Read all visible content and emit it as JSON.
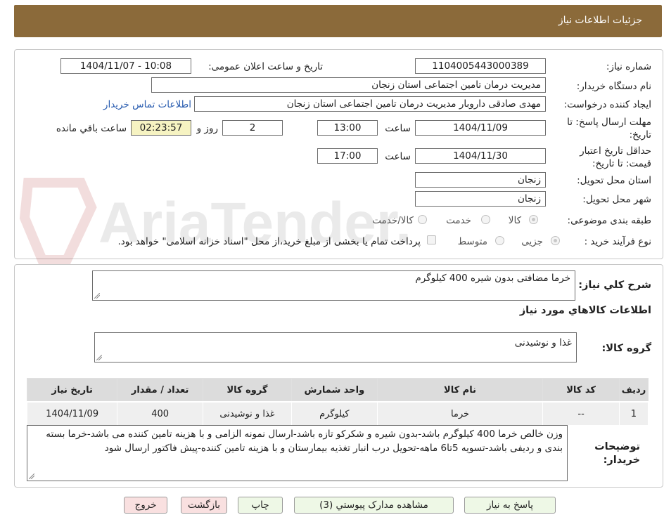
{
  "header": {
    "title": "جزئیات اطلاعات نیاز"
  },
  "form": {
    "need_number_label": "شماره نیاز:",
    "need_number": "1104005443000389",
    "announce_label": "تاریخ و ساعت اعلان عمومی:",
    "announce_value": "1404/11/07 - 10:08",
    "buyer_org_label": "نام دستگاه خریدار:",
    "buyer_org": "مدیریت درمان تامین اجتماعی استان زنجان",
    "requester_label": "ایجاد کننده درخواست:",
    "requester": "مهدی صادقی داروبار مدیریت درمان تامین اجتماعی استان زنجان",
    "buyer_contact_link": "اطلاعات تماس خریدار",
    "reply_deadline_label_1": "مهلت ارسال پاسخ: تا",
    "reply_deadline_label_2": "تاریخ:",
    "reply_date": "1404/11/09",
    "time_label": "ساعت",
    "reply_time": "13:00",
    "days_value": "2",
    "days_label": "روز و",
    "remaining_time": "02:23:57",
    "remaining_label": "ساعت باقي مانده",
    "price_validity_label_1": "حداقل تاریخ اعتبار",
    "price_validity_label_2": "قیمت: تا تاریخ:",
    "validity_date": "1404/11/30",
    "validity_time": "17:00",
    "province_label": "استان محل تحویل:",
    "province": "زنجان",
    "city_label": "شهر محل تحویل:",
    "city": "زنجان",
    "category_label": "طبقه بندی موضوعی:",
    "category_options": [
      "کالا",
      "خدمت",
      "کالا/خدمت"
    ],
    "process_label": "نوع فرآیند خرید :",
    "process_options": [
      "جزیی",
      "متوسط"
    ],
    "payment_note": "پرداخت تمام یا بخشی از مبلغ خرید،از محل \"اسناد خزانه اسلامی\" خواهد بود."
  },
  "details": {
    "summary_label": "شرح کلي نياز:",
    "summary": "خرما مضافتی بدون شیره 400 کیلوگرم",
    "goods_info_title": "اطلاعات کالاهاي مورد نياز",
    "goods_group_label": "گروه کالا:",
    "goods_group": "غذا و نوشیدنی",
    "table_headers": [
      "رديف",
      "کد کالا",
      "نام کالا",
      "واحد شمارش",
      "گروه کالا",
      "تعداد / مقدار",
      "تاريخ نياز"
    ],
    "rows": [
      [
        "1",
        "--",
        "خرما",
        "کیلوگرم",
        "غذا و نوشیدنی",
        "400",
        "1404/11/09"
      ]
    ],
    "buyer_notes_label_1": "توضیحات",
    "buyer_notes_label_2": "خریدار:",
    "buyer_notes": "وزن خالص خرما 400 کیلوگرم باشد-بدون شیره و شکرکو تازه باشد-ارسال نمونه الزامی و با هزینه تامین کننده می باشد-خرما بسته بندی و ردیفی باشد-تسویه 5تا6 ماهه-تحویل درب انبار تغذیه بیمارستان و با هزینه تامین کننده-پیش فاکتور ارسال شود"
  },
  "buttons": {
    "reply": "پاسخ به نياز",
    "documents": "مشاهده مدارک پيوستي (3)",
    "print": "چاپ",
    "back": "بازگشت",
    "exit": "خروج"
  },
  "watermark": "AriaTender.net"
}
